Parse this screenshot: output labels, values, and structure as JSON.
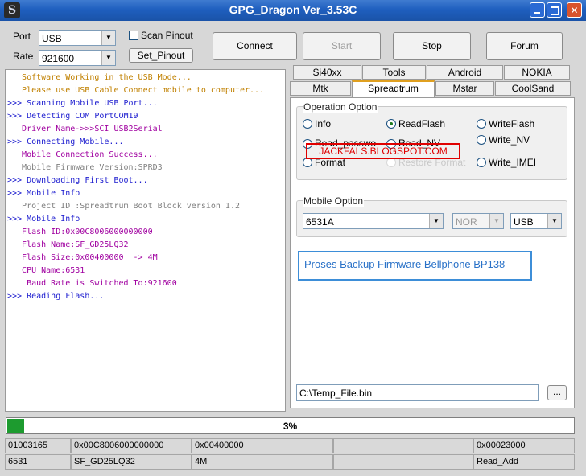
{
  "window": {
    "title": "GPG_Dragon  Ver_3.53C"
  },
  "title_buttons": {
    "minimize": "",
    "maximize": "",
    "close": "✕"
  },
  "connection": {
    "port_label": "Port",
    "port_value": "USB",
    "rate_label": "Rate",
    "rate_value": "921600",
    "scan_pinout_label": "Scan Pinout",
    "set_pinout_label": "Set_Pinout"
  },
  "actions": {
    "connect": "Connect",
    "start": "Start",
    "stop": "Stop",
    "forum": "Forum"
  },
  "log": [
    {
      "text": "   Software Working in the USB Mode...",
      "color": "#c08000"
    },
    {
      "text": "   Please use USB Cable Connect mobile to computer...",
      "color": "#c08000"
    },
    {
      "text": ">>> Scanning Mobile USB Port...",
      "color": "#2020d0"
    },
    {
      "text": ">>> Detecting COM PortCOM19",
      "color": "#2020d0"
    },
    {
      "text": "   Driver Name->>>SCI USB2Serial",
      "color": "#a000a0"
    },
    {
      "text": ">>> Connecting Mobile...",
      "color": "#2020d0"
    },
    {
      "text": "   Mobile Connection Success...",
      "color": "#a000a0"
    },
    {
      "text": "   Mobile Firmware Version:SPRD3",
      "color": "#808080"
    },
    {
      "text": ">>> Downloading First Boot...",
      "color": "#2020d0"
    },
    {
      "text": ">>> Mobile Info",
      "color": "#2020d0"
    },
    {
      "text": "   Project ID :Spreadtrum Boot Block version 1.2",
      "color": "#808080"
    },
    {
      "text": ">>> Mobile Info",
      "color": "#2020d0"
    },
    {
      "text": "   Flash ID:0x00C8006000000000",
      "color": "#a000a0"
    },
    {
      "text": "   Flash Name:SF_GD25LQ32",
      "color": "#a000a0"
    },
    {
      "text": "   Flash Size:0x00400000  -> 4M",
      "color": "#a000a0"
    },
    {
      "text": "   CPU Name:6531",
      "color": "#a000a0"
    },
    {
      "text": "    Baud Rate is Switched To:921600",
      "color": "#a000a0"
    },
    {
      "text": ">>> Reading Flash...",
      "color": "#2020d0"
    }
  ],
  "tabs_row1": [
    "Si40xx",
    "Tools",
    "Android",
    "NOKIA"
  ],
  "tabs_row2": [
    "Mtk",
    "Spreadtrum",
    "Mstar",
    "CoolSand"
  ],
  "active_tab": "Spreadtrum",
  "operation": {
    "title": "Operation Option",
    "info": "Info",
    "read_flash": "ReadFlash",
    "write_flash": "WriteFlash",
    "read_password": "Read_passwo",
    "read_nv": "Read_NV",
    "write_nv": "Write_NV",
    "format": "Format",
    "restore_format": "Restore Format",
    "write_imei": "Write_IMEI",
    "selected": "ReadFlash"
  },
  "watermark": "JACKFALS.BLOGSPOT.COM",
  "mobile_option": {
    "title": "Mobile Option",
    "model": "6531A",
    "flash_type": "NOR",
    "interface": "USB"
  },
  "notice": "Proses Backup Firmware Bellphone BP138",
  "file": {
    "path": "C:\\Temp_File.bin",
    "browse_label": "..."
  },
  "progress": {
    "value": 0.03,
    "text": "3%"
  },
  "status": {
    "row1": [
      "01003165",
      "0x00C8006000000000",
      "0x00400000",
      "",
      "0x00023000"
    ],
    "row2": [
      "6531",
      "SF_GD25LQ32",
      "4M",
      "",
      "Read_Add"
    ]
  },
  "colors": {
    "titlebar": "#1f5fbf",
    "progress": "#1d9b2f",
    "watermark": "#e00000",
    "notice": "#2a72c8"
  }
}
